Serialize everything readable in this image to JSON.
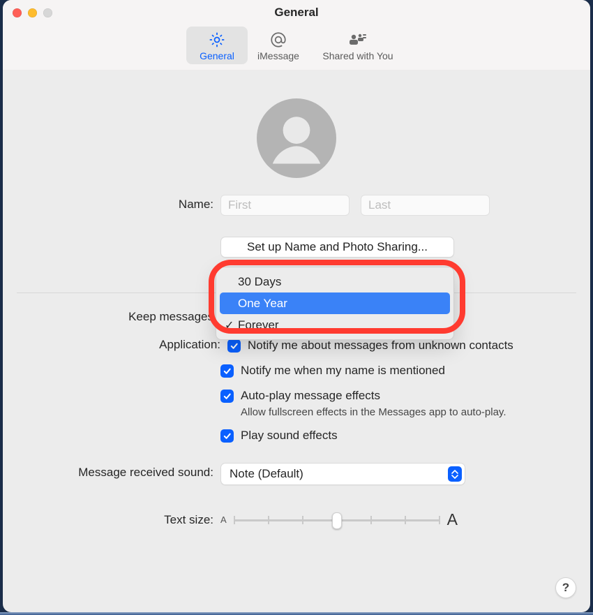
{
  "window": {
    "title": "General"
  },
  "tabs": {
    "general": {
      "label": "General"
    },
    "imessage": {
      "label": "iMessage"
    },
    "shared": {
      "label": "Shared with You"
    }
  },
  "name_section": {
    "label": "Name:",
    "first_placeholder": "First",
    "last_placeholder": "Last",
    "setup_button": "Set up Name and Photo Sharing..."
  },
  "keep_messages": {
    "label": "Keep messages",
    "options": [
      "30 Days",
      "One Year",
      "Forever"
    ],
    "highlighted": "One Year",
    "selected": "Forever"
  },
  "application": {
    "label": "Application:",
    "notify_unknown": {
      "checked": true,
      "label": "Notify me about messages from unknown contacts"
    },
    "notify_mention": {
      "checked": true,
      "label": "Notify me when my name is mentioned"
    },
    "autoplay": {
      "checked": true,
      "label": "Auto-play message effects",
      "sub": "Allow fullscreen effects in the Messages app to auto-play."
    },
    "sound_effects": {
      "checked": true,
      "label": "Play sound effects"
    }
  },
  "received_sound": {
    "label": "Message received sound:",
    "value": "Note (Default)"
  },
  "text_size": {
    "label": "Text size:",
    "ticks": 7,
    "position_index": 3
  },
  "help": {
    "label": "?"
  }
}
